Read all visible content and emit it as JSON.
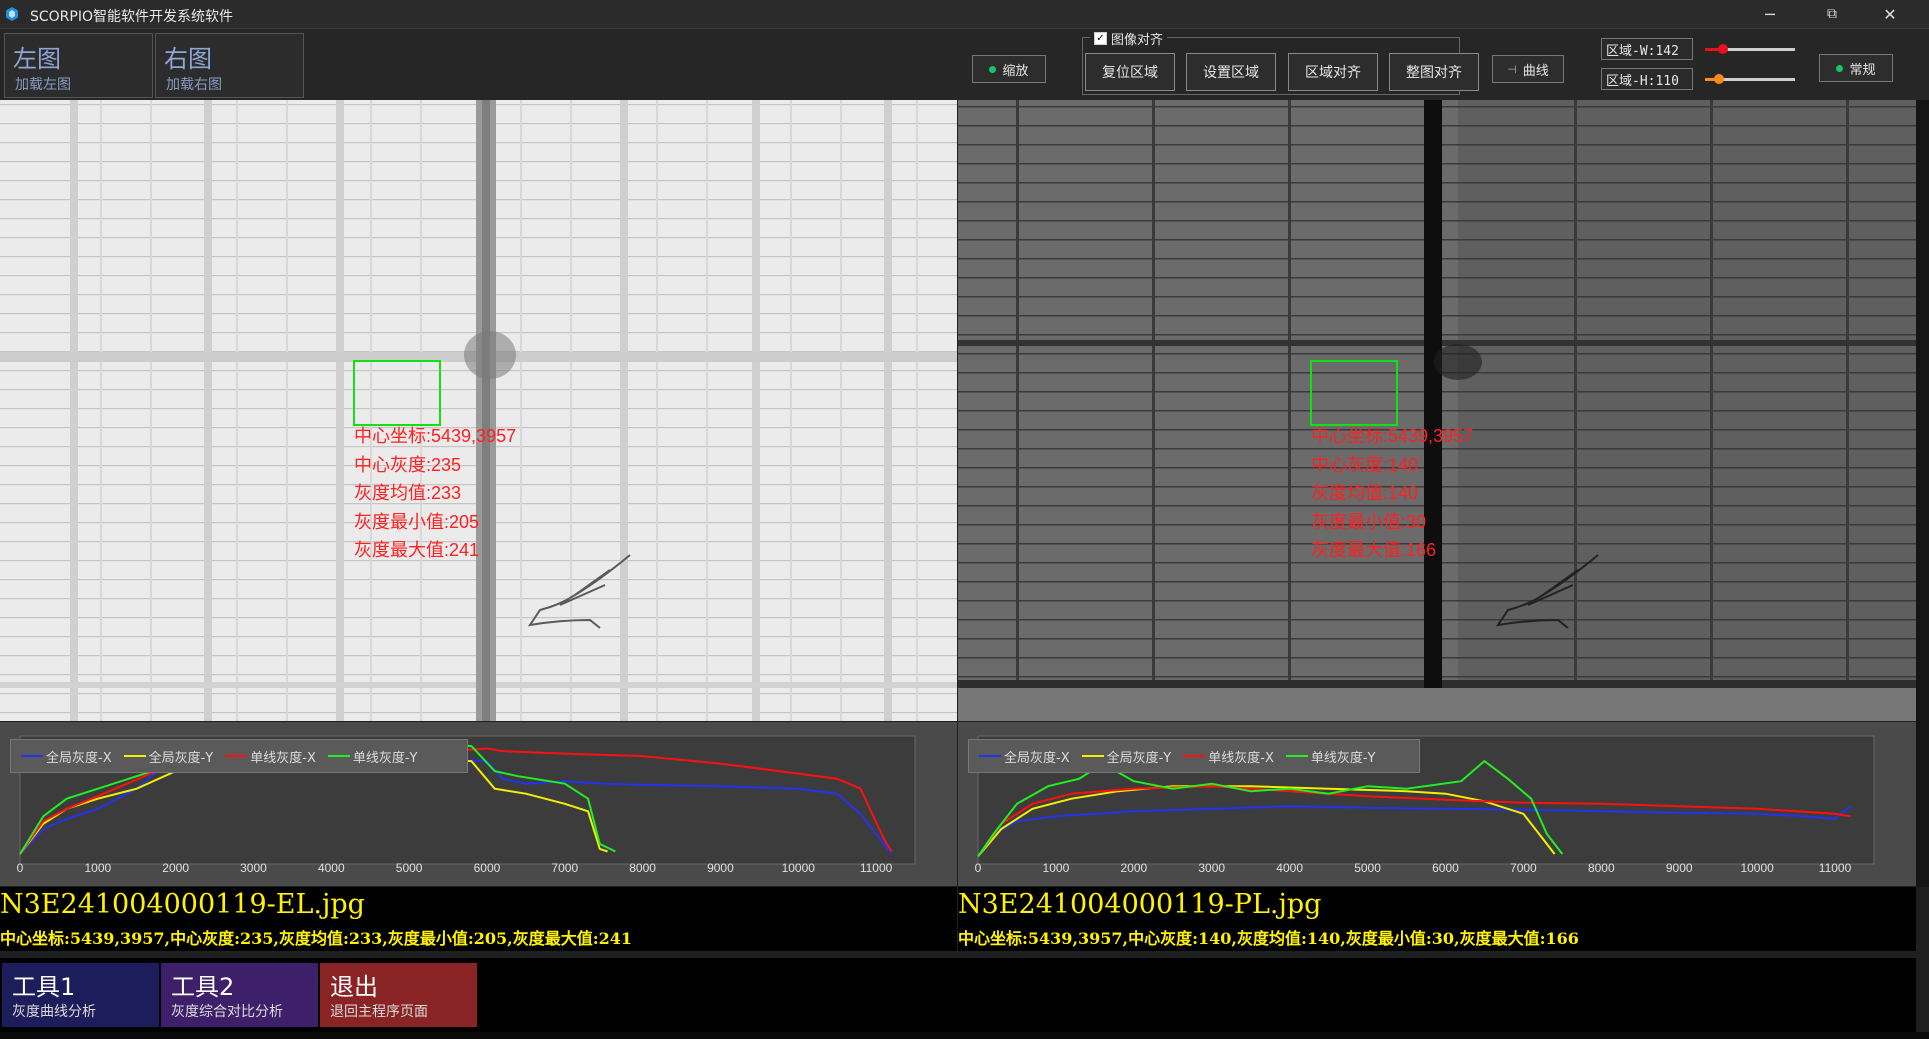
{
  "window": {
    "title": "SCORPIO智能软件开发系统软件",
    "minimize": "─",
    "maximize": "⧉",
    "close": "✕"
  },
  "toolbar": {
    "left_image": {
      "label": "左图",
      "sub": "加载左图"
    },
    "right_image": {
      "label": "右图",
      "sub": "加载右图"
    },
    "zoom_toggle": "缩放",
    "image_align_checkbox": "图像对齐",
    "image_align_checked": true,
    "reset_region": "复位区域",
    "set_region": "设置区域",
    "region_align": "区域对齐",
    "whole_align": "整图对齐",
    "curve_toggle": "曲线",
    "region_w": "区域-W:142",
    "region_h": "区域-H:110",
    "region_w_slider_fraction": 0.2,
    "region_h_slider_fraction": 0.15,
    "normal_toggle": "常规"
  },
  "left_panel": {
    "roi_lines": [
      "中心坐标:5439,3957",
      "中心灰度:235",
      "灰度均值:233",
      "灰度最小值:205",
      "灰度最大值:241"
    ],
    "filename": "N3E241004000119-EL.jpg",
    "info": "中心坐标:5439,3957,中心灰度:235,灰度均值:233,灰度最小值:205,灰度最大值:241"
  },
  "right_panel": {
    "roi_lines": [
      "中心坐标:5439,3957",
      "中心灰度:140",
      "灰度均值:140",
      "灰度最小值:30",
      "灰度最大值:166"
    ],
    "filename": "N3E241004000119-PL.jpg",
    "info": "中心坐标:5439,3957,中心灰度:140,灰度均值:140,灰度最小值:30,灰度最大值:166"
  },
  "bottom": {
    "tool1": {
      "label": "工具1",
      "sub": "灰度曲线分析"
    },
    "tool2": {
      "label": "工具2",
      "sub": "灰度综合对比分析"
    },
    "exit": {
      "label": "退出",
      "sub": "退回主程序页面"
    }
  },
  "colors": {
    "global_x": "#2233ee",
    "global_y": "#f2f000",
    "line_x": "#ff1010",
    "line_y": "#22ee22"
  },
  "chart_data": [
    {
      "type": "line",
      "x_ticks": [
        "0",
        "1000",
        "2000",
        "3000",
        "4000",
        "5000",
        "6000",
        "7000",
        "8000",
        "9000",
        "10000",
        "11000"
      ],
      "xlim": [
        0,
        11500
      ],
      "ylim": [
        0,
        255
      ],
      "legend": "top-left",
      "series": [
        {
          "name": "全局灰度-X",
          "color": "#2233ee",
          "x": [
            0,
            300,
            600,
            1000,
            1500,
            1800,
            2500,
            3500,
            4500,
            5500,
            6000,
            6200,
            6500,
            7000,
            7500,
            8000,
            9000,
            10000,
            10500,
            10800,
            11100,
            11200
          ],
          "y": [
            20,
            70,
            90,
            110,
            150,
            190,
            205,
            210,
            212,
            208,
            205,
            170,
            160,
            165,
            160,
            158,
            155,
            150,
            140,
            100,
            40,
            20
          ]
        },
        {
          "name": "全局灰度-Y",
          "color": "#f2f000",
          "x": [
            0,
            300,
            600,
            1000,
            1500,
            2000,
            3000,
            4000,
            5000,
            5800,
            6100,
            6500,
            7000,
            7300,
            7450,
            7550
          ],
          "y": [
            20,
            80,
            110,
            130,
            150,
            185,
            205,
            208,
            208,
            205,
            150,
            140,
            120,
            105,
            30,
            25
          ]
        },
        {
          "name": "单线灰度-X",
          "color": "#ff1010",
          "x": [
            0,
            300,
            600,
            1000,
            1600,
            2000,
            3000,
            4000,
            5000,
            5800,
            6000,
            6200,
            7000,
            8000,
            9000,
            10000,
            10500,
            10800,
            11100,
            11200
          ],
          "y": [
            20,
            85,
            110,
            135,
            175,
            200,
            220,
            225,
            228,
            228,
            230,
            225,
            220,
            215,
            200,
            180,
            170,
            150,
            50,
            25
          ]
        },
        {
          "name": "单线灰度-Y",
          "color": "#22ee22",
          "x": [
            0,
            300,
            600,
            1000,
            1500,
            2000,
            3000,
            4000,
            5000,
            5800,
            6100,
            6400,
            7000,
            7300,
            7450,
            7650
          ],
          "y": [
            20,
            95,
            130,
            150,
            175,
            200,
            225,
            230,
            235,
            235,
            185,
            175,
            160,
            130,
            40,
            25
          ]
        }
      ]
    },
    {
      "type": "line",
      "x_ticks": [
        "0",
        "1000",
        "2000",
        "3000",
        "4000",
        "5000",
        "6000",
        "7000",
        "8000",
        "9000",
        "10000",
        "11000"
      ],
      "xlim": [
        0,
        11500
      ],
      "ylim": [
        0,
        255
      ],
      "legend": "top-left",
      "series": [
        {
          "name": "全局灰度-X",
          "color": "#2233ee",
          "x": [
            0,
            200,
            500,
            1000,
            1500,
            2000,
            3000,
            4000,
            5000,
            6000,
            7000,
            8000,
            9000,
            10000,
            10500,
            11000,
            11200
          ],
          "y": [
            15,
            60,
            85,
            95,
            100,
            105,
            110,
            115,
            112,
            110,
            108,
            105,
            102,
            100,
            96,
            90,
            115
          ]
        },
        {
          "name": "全局灰度-Y",
          "color": "#f2f000",
          "x": [
            0,
            300,
            700,
            1200,
            1800,
            2500,
            3500,
            4500,
            5500,
            6000,
            6500,
            7000,
            7300,
            7400
          ],
          "y": [
            15,
            70,
            110,
            130,
            145,
            155,
            155,
            150,
            145,
            140,
            125,
            100,
            40,
            20
          ]
        },
        {
          "name": "单线灰度-X",
          "color": "#ff1010",
          "x": [
            0,
            300,
            700,
            1200,
            2000,
            3000,
            4000,
            5000,
            6000,
            7000,
            8000,
            9000,
            10000,
            10500,
            11000,
            11200
          ],
          "y": [
            15,
            80,
            120,
            140,
            150,
            155,
            145,
            135,
            128,
            122,
            120,
            115,
            110,
            105,
            100,
            95
          ]
        },
        {
          "name": "单线灰度-Y",
          "color": "#22ee22",
          "x": [
            0,
            200,
            500,
            900,
            1300,
            1600,
            2000,
            2500,
            3000,
            3500,
            4000,
            4500,
            5000,
            5500,
            6200,
            6500,
            6800,
            7100,
            7300,
            7500
          ],
          "y": [
            15,
            60,
            120,
            155,
            170,
            200,
            165,
            150,
            160,
            145,
            150,
            140,
            155,
            150,
            165,
            205,
            170,
            130,
            60,
            20
          ]
        }
      ]
    }
  ]
}
